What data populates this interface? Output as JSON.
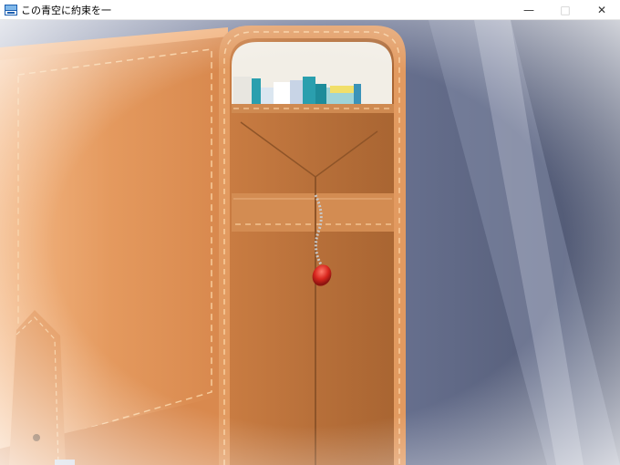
{
  "window": {
    "title": "この青空に約束を一",
    "icon": "app-icon",
    "controls": {
      "minimize": "—",
      "maximize": "□",
      "close": "✕"
    }
  },
  "scene": {
    "description_icon": "school-bag-scene",
    "colors": {
      "leather": "#e0955a",
      "leather_dark": "#b8703a",
      "stitch": "#f3c08a",
      "background_blue": "#5a6380",
      "charm_red": "#d8261e"
    }
  }
}
